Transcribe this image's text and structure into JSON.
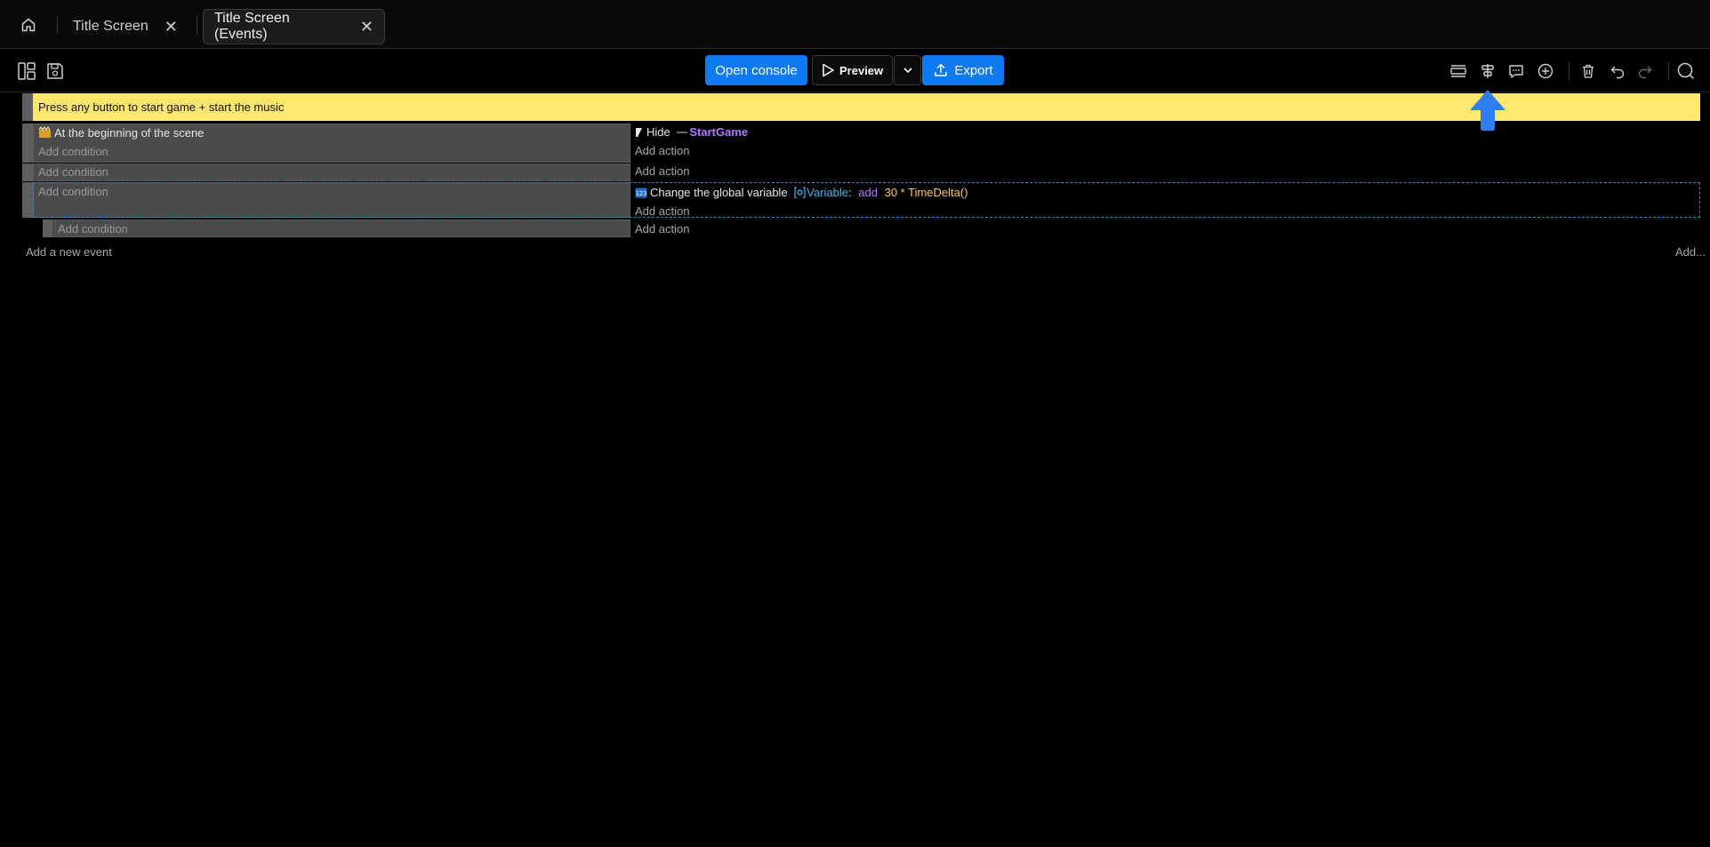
{
  "tabs": [
    {
      "label": "Title Screen",
      "active": false
    },
    {
      "label": "Title Screen (Events)",
      "active": true
    }
  ],
  "toolbar": {
    "open_console": "Open console",
    "preview": "Preview",
    "export": "Export",
    "accent": "#0d7af2"
  },
  "events": {
    "comment": "Press any button to start game + start the music",
    "comment_color": "#ffe66f",
    "event1": {
      "condition": "At the beginning of the scene",
      "add_condition": "Add condition",
      "action_verb": "Hide",
      "action_object": "StartGame",
      "add_action": "Add action"
    },
    "event2": {
      "add_condition": "Add condition",
      "add_action": "Add action"
    },
    "event3": {
      "add_condition": "Add condition",
      "action_text": "Change the global variable",
      "action_var": "Variable",
      "action_colon": ":",
      "action_op": "add",
      "action_expr": "30 * TimeDelta()",
      "add_action": "Add action"
    },
    "sub_event": {
      "add_condition": "Add condition",
      "add_action": "Add action"
    },
    "add_new_event": "Add a new event",
    "add_more": "Add..."
  },
  "icons": [
    "home-icon",
    "close-icon",
    "panels-icon",
    "save-icon",
    "play-icon",
    "chevron-down-icon",
    "upload-icon",
    "add-event-icon",
    "add-subevent-icon",
    "comment-icon",
    "add-circle-icon",
    "trash-icon",
    "undo-icon",
    "redo-icon",
    "search-icon",
    "arrow-up-icon"
  ]
}
